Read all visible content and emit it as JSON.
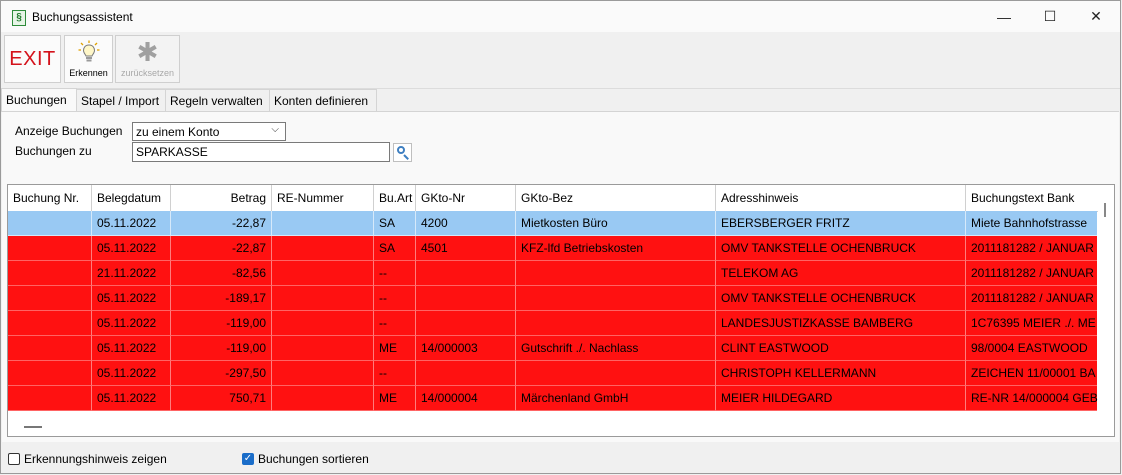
{
  "window": {
    "title": "Buchungsassistent",
    "app_icon_glyph": "§",
    "controls": {
      "minimize": "—",
      "maximize": "☐",
      "close": "✕"
    }
  },
  "toolbar": {
    "exit_label": "EXIT",
    "erkennen_label": "Erkennen",
    "zuruecksetzen_label": "zurücksetzen"
  },
  "tabs": [
    {
      "label": "Buchungen",
      "active": true
    },
    {
      "label": "Stapel / Import",
      "active": false
    },
    {
      "label": "Regeln verwalten",
      "active": false
    },
    {
      "label": "Konten definieren",
      "active": false
    }
  ],
  "filters": {
    "anzeige_label": "Anzeige Buchungen",
    "anzeige_value": "zu einem Konto",
    "buchungen_zu_label": "Buchungen zu",
    "buchungen_zu_value": "SPARKASSE"
  },
  "grid": {
    "columns": [
      "Buchung Nr.",
      "Belegdatum",
      "Betrag",
      "RE-Nummer",
      "Bu.Art",
      "GKto-Nr",
      "GKto-Bez",
      "Adresshinweis",
      "Buchungstext Bank"
    ],
    "rows": [
      {
        "status": "selected",
        "cells": [
          "",
          "05.11.2022",
          "-22,87",
          "",
          "SA",
          "4200",
          "Mietkosten Büro",
          "EBERSBERGER FRITZ",
          "Miete Bahnhofstrasse"
        ]
      },
      {
        "status": "error",
        "cells": [
          "",
          "05.11.2022",
          "-22,87",
          "",
          "SA",
          "4501",
          "KFZ-lfd Betriebskosten",
          "OMV TANKSTELLE OCHENBRUCK",
          "2011181282 / JANUAR"
        ]
      },
      {
        "status": "error",
        "cells": [
          "",
          "21.11.2022",
          "-82,56",
          "",
          "--",
          "",
          "",
          "TELEKOM AG",
          "2011181282 / JANUAR"
        ]
      },
      {
        "status": "error",
        "cells": [
          "",
          "05.11.2022",
          "-189,17",
          "",
          "--",
          "",
          "",
          "OMV TANKSTELLE OCHENBRUCK",
          "2011181282 / JANUAR"
        ]
      },
      {
        "status": "error",
        "cells": [
          "",
          "05.11.2022",
          "-119,00",
          "",
          "--",
          "",
          "",
          "LANDESJUSTIZKASSE BAMBERG",
          "1C76395 MEIER ./. ME"
        ]
      },
      {
        "status": "error",
        "cells": [
          "",
          "05.11.2022",
          "-119,00",
          "",
          "ME",
          "14/000003",
          "Gutschrift ./. Nachlass",
          "CLINT EASTWOOD",
          "98/0004 EASTWOOD"
        ]
      },
      {
        "status": "error",
        "cells": [
          "",
          "05.11.2022",
          "-297,50",
          "",
          "--",
          "",
          "",
          "CHRISTOPH KELLERMANN",
          "ZEICHEN 11/00001 BA"
        ]
      },
      {
        "status": "error",
        "cells": [
          "",
          "05.11.2022",
          "750,71",
          "",
          "ME",
          "14/000004",
          "Märchenland GmbH",
          "MEIER HILDEGARD",
          "RE-NR 14/000004 GEB"
        ]
      }
    ]
  },
  "options": {
    "erkennungshinweis_label": "Erkennungshinweis zeigen",
    "erkennungshinweis_checked": false,
    "sortieren_label": "Buchungen sortieren",
    "sortieren_checked": true
  },
  "colors": {
    "selected_row": "#99c9f3",
    "error_row": "#ff1111",
    "exit_text": "#d4121b",
    "checkbox_accent": "#1a6dc9"
  },
  "icons": {
    "erkennen": "lightbulb-icon",
    "zuruecksetzen": "reset-asterisk-icon",
    "search": "magnifier-icon"
  }
}
